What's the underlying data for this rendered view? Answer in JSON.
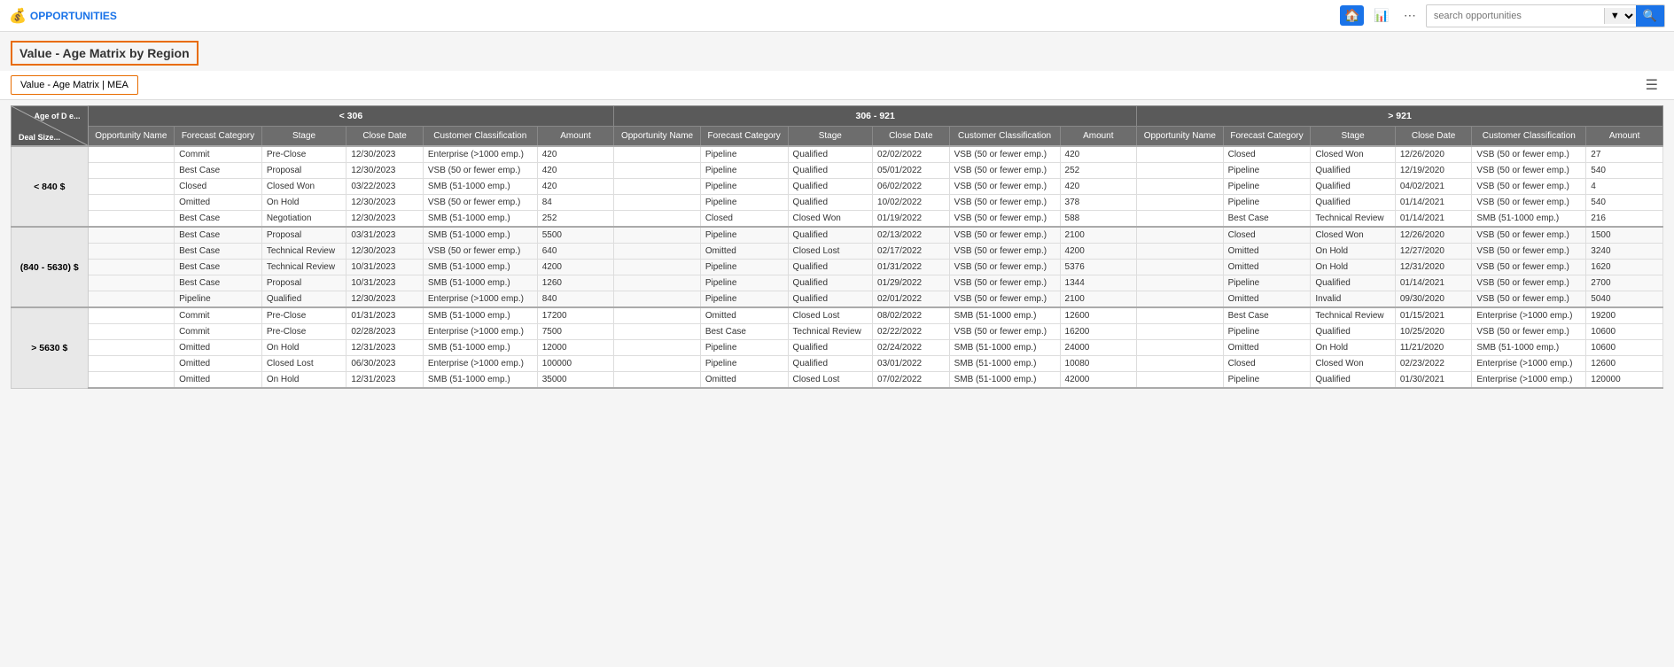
{
  "app": {
    "title": "OPPORTUNITIES",
    "logo_icon": "💰"
  },
  "nav": {
    "home_icon": "🏠",
    "chart_icon": "📊",
    "more_icon": "⋯",
    "search_placeholder": "search opportunities",
    "search_button": "🔍"
  },
  "page_title": "Value - Age Matrix by Region",
  "tabs": [
    {
      "label": "Value - Age Matrix | MEA",
      "active": true
    }
  ],
  "table": {
    "corner_label_age": "Age of D e...",
    "corner_label_deal": "Deal Size...",
    "groups": [
      {
        "label": "< 306",
        "cols": 6
      },
      {
        "label": "306 - 921",
        "cols": 6
      },
      {
        "label": "> 921",
        "cols": 6
      }
    ],
    "col_headers": [
      "Opportunity Name",
      "Forecast Category",
      "Stage",
      "Close Date",
      "Customer Classification",
      "Amount"
    ],
    "row_groups": [
      {
        "label": "< 840 $",
        "rows": [
          {
            "g1": [
              "",
              "Commit",
              "Pre-Close",
              "12/30/2023",
              "Enterprise (>1000 emp.)",
              "420"
            ],
            "g2": [
              "",
              "Pipeline",
              "Qualified",
              "02/02/2022",
              "VSB (50 or fewer emp.)",
              "420"
            ],
            "g3": [
              "",
              "Closed",
              "Closed Won",
              "12/26/2020",
              "VSB (50 or fewer emp.)",
              "27"
            ]
          },
          {
            "g1": [
              "",
              "Best Case",
              "Proposal",
              "12/30/2023",
              "VSB (50 or fewer emp.)",
              "420"
            ],
            "g2": [
              "",
              "Pipeline",
              "Qualified",
              "05/01/2022",
              "VSB (50 or fewer emp.)",
              "252"
            ],
            "g3": [
              "",
              "Pipeline",
              "Qualified",
              "12/19/2020",
              "VSB (50 or fewer emp.)",
              "540"
            ]
          },
          {
            "g1": [
              "",
              "Closed",
              "Closed Won",
              "03/22/2023",
              "SMB (51-1000 emp.)",
              "420"
            ],
            "g2": [
              "",
              "Pipeline",
              "Qualified",
              "06/02/2022",
              "VSB (50 or fewer emp.)",
              "420"
            ],
            "g3": [
              "",
              "Pipeline",
              "Qualified",
              "04/02/2021",
              "VSB (50 or fewer emp.)",
              "4"
            ]
          },
          {
            "g1": [
              "",
              "Omitted",
              "On Hold",
              "12/30/2023",
              "VSB (50 or fewer emp.)",
              "84"
            ],
            "g2": [
              "",
              "Pipeline",
              "Qualified",
              "10/02/2022",
              "VSB (50 or fewer emp.)",
              "378"
            ],
            "g3": [
              "",
              "Pipeline",
              "Qualified",
              "01/14/2021",
              "VSB (50 or fewer emp.)",
              "540"
            ]
          },
          {
            "g1": [
              "",
              "Best Case",
              "Negotiation",
              "12/30/2023",
              "SMB (51-1000 emp.)",
              "252"
            ],
            "g2": [
              "",
              "Closed",
              "Closed Won",
              "01/19/2022",
              "VSB (50 or fewer emp.)",
              "588"
            ],
            "g3": [
              "",
              "Best Case",
              "Technical Review",
              "01/14/2021",
              "SMB (51-1000 emp.)",
              "216"
            ]
          }
        ]
      },
      {
        "label": "(840 - 5630) $",
        "rows": [
          {
            "g1": [
              "",
              "Best Case",
              "Proposal",
              "03/31/2023",
              "SMB (51-1000 emp.)",
              "5500"
            ],
            "g2": [
              "",
              "Pipeline",
              "Qualified",
              "02/13/2022",
              "VSB (50 or fewer emp.)",
              "2100"
            ],
            "g3": [
              "",
              "Closed",
              "Closed Won",
              "12/26/2020",
              "VSB (50 or fewer emp.)",
              "1500"
            ]
          },
          {
            "g1": [
              "",
              "Best Case",
              "Technical Review",
              "12/30/2023",
              "VSB (50 or fewer emp.)",
              "640"
            ],
            "g2": [
              "",
              "Omitted",
              "Closed Lost",
              "02/17/2022",
              "VSB (50 or fewer emp.)",
              "4200"
            ],
            "g3": [
              "",
              "Omitted",
              "On Hold",
              "12/27/2020",
              "VSB (50 or fewer emp.)",
              "3240"
            ]
          },
          {
            "g1": [
              "",
              "Best Case",
              "Technical Review",
              "10/31/2023",
              "SMB (51-1000 emp.)",
              "4200"
            ],
            "g2": [
              "",
              "Pipeline",
              "Qualified",
              "01/31/2022",
              "VSB (50 or fewer emp.)",
              "5376"
            ],
            "g3": [
              "",
              "Omitted",
              "On Hold",
              "12/31/2020",
              "VSB (50 or fewer emp.)",
              "1620"
            ]
          },
          {
            "g1": [
              "",
              "Best Case",
              "Proposal",
              "10/31/2023",
              "SMB (51-1000 emp.)",
              "1260"
            ],
            "g2": [
              "",
              "Pipeline",
              "Qualified",
              "01/29/2022",
              "VSB (50 or fewer emp.)",
              "1344"
            ],
            "g3": [
              "",
              "Pipeline",
              "Qualified",
              "01/14/2021",
              "VSB (50 or fewer emp.)",
              "2700"
            ]
          },
          {
            "g1": [
              "",
              "Pipeline",
              "Qualified",
              "12/30/2023",
              "Enterprise (>1000 emp.)",
              "840"
            ],
            "g2": [
              "",
              "Pipeline",
              "Qualified",
              "02/01/2022",
              "VSB (50 or fewer emp.)",
              "2100"
            ],
            "g3": [
              "",
              "Omitted",
              "Invalid",
              "09/30/2020",
              "VSB (50 or fewer emp.)",
              "5040"
            ]
          }
        ]
      },
      {
        "label": "> 5630 $",
        "rows": [
          {
            "g1": [
              "",
              "Commit",
              "Pre-Close",
              "01/31/2023",
              "SMB (51-1000 emp.)",
              "17200"
            ],
            "g2": [
              "",
              "Omitted",
              "Closed Lost",
              "08/02/2022",
              "SMB (51-1000 emp.)",
              "12600"
            ],
            "g3": [
              "",
              "Best Case",
              "Technical Review",
              "01/15/2021",
              "Enterprise (>1000 emp.)",
              "19200"
            ]
          },
          {
            "g1": [
              "",
              "Commit",
              "Pre-Close",
              "02/28/2023",
              "Enterprise (>1000 emp.)",
              "7500"
            ],
            "g2": [
              "",
              "Best Case",
              "Technical Review",
              "02/22/2022",
              "VSB (50 or fewer emp.)",
              "16200"
            ],
            "g3": [
              "",
              "Pipeline",
              "Qualified",
              "10/25/2020",
              "VSB (50 or fewer emp.)",
              "10600"
            ]
          },
          {
            "g1": [
              "",
              "Omitted",
              "On Hold",
              "12/31/2023",
              "SMB (51-1000 emp.)",
              "12000"
            ],
            "g2": [
              "",
              "Pipeline",
              "Qualified",
              "02/24/2022",
              "SMB (51-1000 emp.)",
              "24000"
            ],
            "g3": [
              "",
              "Omitted",
              "On Hold",
              "11/21/2020",
              "SMB (51-1000 emp.)",
              "10600"
            ]
          },
          {
            "g1": [
              "",
              "Omitted",
              "Closed Lost",
              "06/30/2023",
              "Enterprise (>1000 emp.)",
              "100000"
            ],
            "g2": [
              "",
              "Pipeline",
              "Qualified",
              "03/01/2022",
              "SMB (51-1000 emp.)",
              "10080"
            ],
            "g3": [
              "",
              "Closed",
              "Closed Won",
              "02/23/2022",
              "Enterprise (>1000 emp.)",
              "12600"
            ]
          },
          {
            "g1": [
              "",
              "Omitted",
              "On Hold",
              "12/31/2023",
              "SMB (51-1000 emp.)",
              "35000"
            ],
            "g2": [
              "",
              "Omitted",
              "Closed Lost",
              "07/02/2022",
              "SMB (51-1000 emp.)",
              "42000"
            ],
            "g3": [
              "",
              "Pipeline",
              "Qualified",
              "01/30/2021",
              "Enterprise (>1000 emp.)",
              "120000"
            ]
          }
        ]
      }
    ]
  }
}
